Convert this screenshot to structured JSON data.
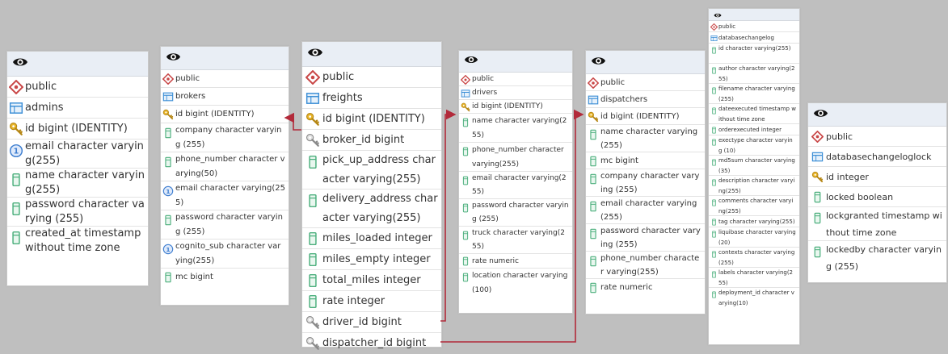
{
  "tables": [
    {
      "id": "admins",
      "rows": [
        {
          "icon": "schema",
          "text": "public"
        },
        {
          "icon": "table",
          "text": "admins"
        },
        {
          "icon": "pk",
          "text": "id bigint (IDENTITY)"
        },
        {
          "icon": "unique",
          "text": "email character varying(255)"
        },
        {
          "icon": "column",
          "text": "name character varying(255)"
        },
        {
          "icon": "column",
          "text": "password character varying (255)"
        },
        {
          "icon": "column",
          "text": "created_at timestamp without time zone"
        }
      ]
    },
    {
      "id": "brokers",
      "rows": [
        {
          "icon": "schema",
          "text": "public"
        },
        {
          "icon": "table",
          "text": "brokers"
        },
        {
          "icon": "pk",
          "text": "id bigint (IDENTITY)"
        },
        {
          "icon": "column",
          "text": "company character varying (255)"
        },
        {
          "icon": "column",
          "text": "phone_number character varying(50)"
        },
        {
          "icon": "unique",
          "text": "email character varying(255)"
        },
        {
          "icon": "column",
          "text": "password character varying (255)"
        },
        {
          "icon": "unique",
          "text": "cognito_sub character varying(255)"
        },
        {
          "icon": "column",
          "text": "mc bigint"
        }
      ]
    },
    {
      "id": "freights",
      "rows": [
        {
          "icon": "schema",
          "text": "public"
        },
        {
          "icon": "table",
          "text": "freights"
        },
        {
          "icon": "pk",
          "text": "id bigint (IDENTITY)"
        },
        {
          "icon": "fk",
          "text": "broker_id bigint"
        },
        {
          "icon": "column",
          "text": "pick_up_address character varying(255)"
        },
        {
          "icon": "column",
          "text": "delivery_address character varying(255)"
        },
        {
          "icon": "column",
          "text": "miles_loaded integer"
        },
        {
          "icon": "column",
          "text": "miles_empty integer"
        },
        {
          "icon": "column",
          "text": "total_miles integer"
        },
        {
          "icon": "column",
          "text": "rate integer"
        },
        {
          "icon": "fk",
          "text": "driver_id bigint"
        },
        {
          "icon": "fk",
          "text": "dispatcher_id bigint"
        }
      ]
    },
    {
      "id": "drivers",
      "rows": [
        {
          "icon": "schema",
          "text": "public"
        },
        {
          "icon": "table",
          "text": "drivers"
        },
        {
          "icon": "pk",
          "text": "id bigint (IDENTITY)"
        },
        {
          "icon": "column",
          "text": "name character varying(255)"
        },
        {
          "icon": "column",
          "text": "phone_number character varying(255)"
        },
        {
          "icon": "column",
          "text": "email character varying(255)"
        },
        {
          "icon": "column",
          "text": "password character varying (255)"
        },
        {
          "icon": "column",
          "text": "truck character varying(255)"
        },
        {
          "icon": "column",
          "text": "rate numeric"
        },
        {
          "icon": "column",
          "text": "location character varying (100)"
        }
      ]
    },
    {
      "id": "dispatchers",
      "rows": [
        {
          "icon": "schema",
          "text": "public"
        },
        {
          "icon": "table",
          "text": "dispatchers"
        },
        {
          "icon": "pk",
          "text": "id bigint (IDENTITY)"
        },
        {
          "icon": "column",
          "text": "name character varying(255)"
        },
        {
          "icon": "column",
          "text": "mc bigint"
        },
        {
          "icon": "column",
          "text": "company character varying (255)"
        },
        {
          "icon": "column",
          "text": "email character varying(255)"
        },
        {
          "icon": "column",
          "text": "password character varying (255)"
        },
        {
          "icon": "column",
          "text": "phone_number character varying(255)"
        },
        {
          "icon": "column",
          "text": "rate numeric"
        }
      ]
    },
    {
      "id": "databasechangelog",
      "rows": [
        {
          "icon": "schema",
          "text": "public"
        },
        {
          "icon": "table",
          "text": "databasechangelog"
        },
        {
          "icon": "column",
          "text": "id character varying(255)"
        },
        {
          "icon": "column",
          "text": "author character varying(255)"
        },
        {
          "icon": "column",
          "text": "filename character varying (255)"
        },
        {
          "icon": "column",
          "text": "dateexecuted timestamp without time zone"
        },
        {
          "icon": "column",
          "text": "orderexecuted integer"
        },
        {
          "icon": "column",
          "text": "exectype character varying (10)"
        },
        {
          "icon": "column",
          "text": "md5sum character varying (35)"
        },
        {
          "icon": "column",
          "text": "description character varying(255)"
        },
        {
          "icon": "column",
          "text": "comments character varying(255)"
        },
        {
          "icon": "column",
          "text": "tag character varying(255)"
        },
        {
          "icon": "column",
          "text": "liquibase character varying (20)"
        },
        {
          "icon": "column",
          "text": "contexts character varying (255)"
        },
        {
          "icon": "column",
          "text": "labels character varying(255)"
        },
        {
          "icon": "column",
          "text": "deployment_id character varying(10)"
        }
      ]
    },
    {
      "id": "databasechangeloglock",
      "rows": [
        {
          "icon": "schema",
          "text": "public"
        },
        {
          "icon": "table",
          "text": "databasechangeloglock"
        },
        {
          "icon": "pk",
          "text": "id integer"
        },
        {
          "icon": "column",
          "text": "locked boolean"
        },
        {
          "icon": "column",
          "text": "lockgranted timestamp without time zone"
        },
        {
          "icon": "column",
          "text": "lockedby character varying (255)"
        }
      ]
    }
  ],
  "colors": {
    "background": "#bfbfbf",
    "header": "#e9eef5",
    "link": "#b22a3a",
    "schema": "#c94747",
    "table": "#3d8fd6",
    "key": "#d8a41c",
    "column": "#4caf7d",
    "unique": "#3f7fd0"
  }
}
